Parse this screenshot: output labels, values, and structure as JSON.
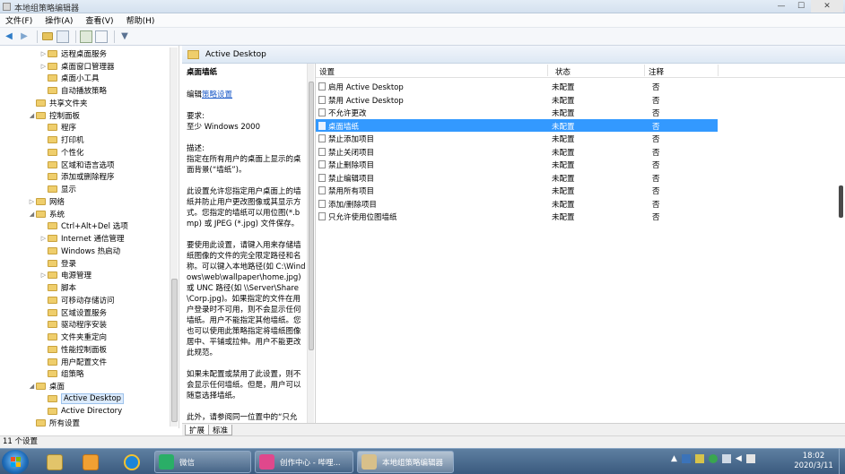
{
  "window": {
    "title": "本地组策略编辑器",
    "minimize_glyph": "—",
    "maximize_glyph": "☐",
    "close_glyph": "✕"
  },
  "menu": [
    "文件(F)",
    "操作(A)",
    "查看(V)",
    "帮助(H)"
  ],
  "toolbar": {
    "back_glyph": "◀",
    "forward_glyph": "▶",
    "filter_glyph": "▼"
  },
  "tree": {
    "items": [
      {
        "label": "远程桌面服务",
        "level": 3,
        "expander": "▷"
      },
      {
        "label": "桌面窗口管理器",
        "level": 3,
        "expander": "▷"
      },
      {
        "label": "桌面小工具",
        "level": 3,
        "expander": ""
      },
      {
        "label": "自动播放策略",
        "level": 3,
        "expander": ""
      },
      {
        "label": "共享文件夹",
        "level": 2,
        "expander": ""
      },
      {
        "label": "控制面板",
        "level": 2,
        "expander": "◢"
      },
      {
        "label": "程序",
        "level": 3,
        "expander": ""
      },
      {
        "label": "打印机",
        "level": 3,
        "expander": ""
      },
      {
        "label": "个性化",
        "level": 3,
        "expander": ""
      },
      {
        "label": "区域和语言选项",
        "level": 3,
        "expander": ""
      },
      {
        "label": "添加或删除程序",
        "level": 3,
        "expander": ""
      },
      {
        "label": "显示",
        "level": 3,
        "expander": ""
      },
      {
        "label": "网络",
        "level": 2,
        "expander": "▷"
      },
      {
        "label": "系统",
        "level": 2,
        "expander": "◢"
      },
      {
        "label": "Ctrl+Alt+Del 选项",
        "level": 3,
        "expander": ""
      },
      {
        "label": "Internet 通信管理",
        "level": 3,
        "expander": "▷"
      },
      {
        "label": "Windows 热启动",
        "level": 3,
        "expander": ""
      },
      {
        "label": "登录",
        "level": 3,
        "expander": ""
      },
      {
        "label": "电源管理",
        "level": 3,
        "expander": "▷"
      },
      {
        "label": "脚本",
        "level": 3,
        "expander": ""
      },
      {
        "label": "可移动存储访问",
        "level": 3,
        "expander": ""
      },
      {
        "label": "区域设置服务",
        "level": 3,
        "expander": ""
      },
      {
        "label": "驱动程序安装",
        "level": 3,
        "expander": ""
      },
      {
        "label": "文件夹重定向",
        "level": 3,
        "expander": ""
      },
      {
        "label": "性能控制面板",
        "level": 3,
        "expander": ""
      },
      {
        "label": "用户配置文件",
        "level": 3,
        "expander": ""
      },
      {
        "label": "组策略",
        "level": 3,
        "expander": ""
      },
      {
        "label": "桌面",
        "level": 2,
        "expander": "◢"
      },
      {
        "label": "Active Desktop",
        "level": 3,
        "expander": "",
        "selected": true
      },
      {
        "label": "Active Directory",
        "level": 3,
        "expander": ""
      },
      {
        "label": "所有设置",
        "level": 2,
        "expander": ""
      }
    ]
  },
  "breadcrumb": "Active Desktop",
  "description": {
    "title": "桌面墙纸",
    "edit_prefix": "编辑",
    "edit_link": "策略设置",
    "requirements": "要求:\n至少 Windows 2000",
    "description": "描述:\n指定在所有用户的桌面上显示的桌面背景(“墙纸”)。",
    "para1": "此设置允许您指定用户桌面上的墙纸并防止用户更改图像或其显示方式。您指定的墙纸可以用位图(*.bmp) 或 JPEG (*.jpg) 文件保存。",
    "para2": "要使用此设置，请键入用来存储墙纸图像的文件的完全限定路径和名称。可以键入本地路径(如 C:\\Windows\\web\\wallpaper\\home.jpg)或 UNC 路径(如 \\\\Server\\Share\\Corp.jpg)。如果指定的文件在用户登录时不可用，则不会显示任何墙纸。用户不能指定其他墙纸。您也可以使用此策略指定将墙纸图像居中、平铺或拉伸。用户不能更改此规范。",
    "para3": "如果未配置或禁用了此设置，则不会显示任何墙纸。但是，用户可以随意选择墙纸。",
    "para4": "此外，请参阅同一位置中的“只允"
  },
  "list": {
    "columns": {
      "setting": "设置",
      "state": "状态",
      "comment": "注释"
    },
    "rows": [
      {
        "name": "启用 Active Desktop",
        "state": "未配置",
        "comment": "否"
      },
      {
        "name": "禁用 Active Desktop",
        "state": "未配置",
        "comment": "否"
      },
      {
        "name": "不允许更改",
        "state": "未配置",
        "comment": "否"
      },
      {
        "name": "桌面墙纸",
        "state": "未配置",
        "comment": "否",
        "selected": true
      },
      {
        "name": "禁止添加项目",
        "state": "未配置",
        "comment": "否"
      },
      {
        "name": "禁止关闭项目",
        "state": "未配置",
        "comment": "否"
      },
      {
        "name": "禁止删除项目",
        "state": "未配置",
        "comment": "否"
      },
      {
        "name": "禁止编辑项目",
        "state": "未配置",
        "comment": "否"
      },
      {
        "name": "禁用所有项目",
        "state": "未配置",
        "comment": "否"
      },
      {
        "name": "添加/删除项目",
        "state": "未配置",
        "comment": "否"
      },
      {
        "name": "只允许使用位图墙纸",
        "state": "未配置",
        "comment": "否"
      }
    ]
  },
  "tabs": [
    "扩展",
    "标准"
  ],
  "status": "11 个设置",
  "taskbar": {
    "tasks": [
      {
        "label": "微信",
        "color": "#2aae67"
      },
      {
        "label": "创作中心 - 哔哩...",
        "color": "#e0488c"
      },
      {
        "label": "本地组策略编辑器",
        "color": "#d8c08a",
        "active": true
      }
    ],
    "clock_time": "18:02",
    "clock_date": "2020/3/11",
    "colors": {
      "flag_red": "#f25022",
      "flag_green": "#7fba00",
      "flag_blue": "#00a4ef",
      "flag_yellow": "#ffb900"
    }
  }
}
